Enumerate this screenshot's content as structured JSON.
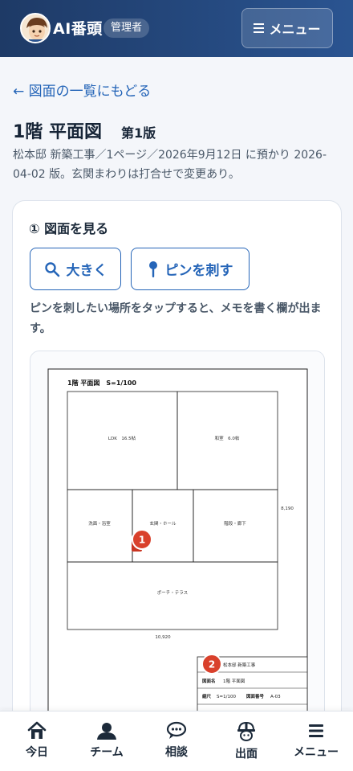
{
  "header": {
    "app_title": "AI番頭",
    "role_badge": "管理者",
    "menu_label": "メニュー"
  },
  "back_link": "← 図面の一覧にもどる",
  "page_title": "1階 平面図",
  "version": "第1版",
  "meta_text": "松本邸 新築工事／1ページ／2026年9月12日 に預かり 2026-04-02 版。玄関まわりは打合せで変更あり。",
  "section": {
    "title": "① 図面を見る",
    "zoom_button": "大きく",
    "pin_button": "ピンを刺す",
    "hint": "ピンを刺したい場所をタップすると、メモを書く欄が出ます。"
  },
  "drawing": {
    "title": "1階 平面図　S=1/100",
    "rooms": {
      "ldk": "LDK　16.5帖",
      "washitsu": "和室　6.0帖",
      "bath": "洗面・浴室",
      "entrance": "玄関・ホール",
      "stairs": "階段・廊下",
      "porch": "ポーチ・テラス"
    },
    "dim_height": "8,190",
    "dim_width": "10,920",
    "title_block": {
      "project": "松本邸 新築工事",
      "name_label": "図面名",
      "name_value": "1階 平面図",
      "scale_label": "縮尺",
      "scale_value": "S=1/100",
      "number_label": "図面番号",
      "number_value": "A-03"
    },
    "pins": [
      {
        "number": "1"
      },
      {
        "number": "2"
      }
    ]
  },
  "tabs": [
    {
      "label": "今日",
      "icon": "house-icon"
    },
    {
      "label": "チーム",
      "icon": "people-icon"
    },
    {
      "label": "相談",
      "icon": "chat-icon"
    },
    {
      "label": "出面",
      "icon": "helmet-icon"
    },
    {
      "label": "メニュー",
      "icon": "menu-icon"
    }
  ],
  "colors": {
    "header": "#1e3a66",
    "accent": "#2565b8",
    "pin": "#d9412c"
  }
}
